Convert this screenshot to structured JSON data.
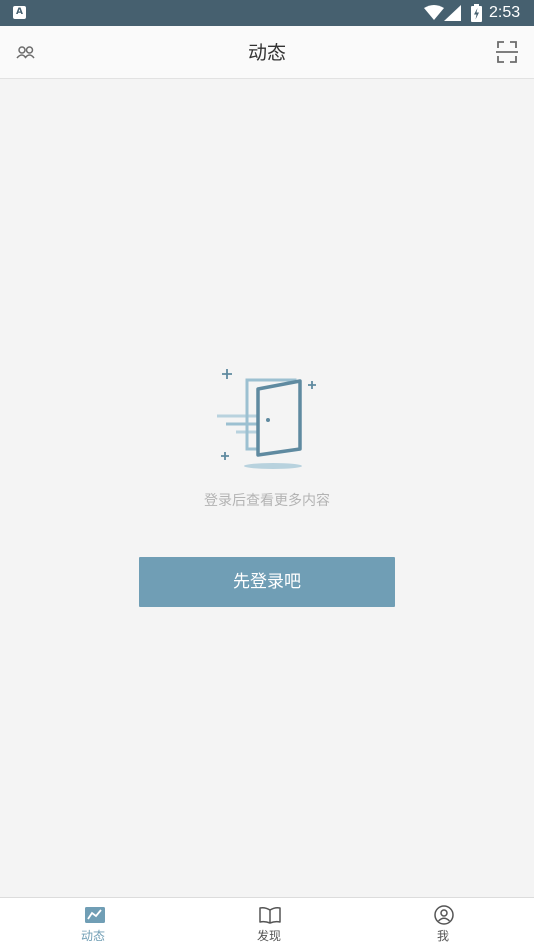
{
  "status_bar": {
    "app_icon_letter": "A",
    "time": "2:53",
    "icons": [
      "wifi-icon",
      "signal-icon",
      "battery-charging-icon"
    ]
  },
  "header": {
    "title": "动态",
    "left_icon": "friends-icon",
    "right_icon": "scan-icon"
  },
  "empty_state": {
    "illustration": "door-login-icon",
    "message": "登录后查看更多内容",
    "login_button_label": "先登录吧"
  },
  "bottom_nav": {
    "items": [
      {
        "label": "动态",
        "icon": "feed-icon",
        "active": true
      },
      {
        "label": "发现",
        "icon": "book-icon",
        "active": false
      },
      {
        "label": "我",
        "icon": "profile-icon",
        "active": false
      }
    ]
  },
  "colors": {
    "status_bar": "#46606f",
    "accent": "#709eb5",
    "background": "#f4f4f4"
  }
}
